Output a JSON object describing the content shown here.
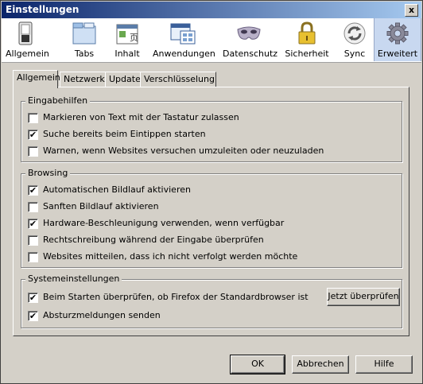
{
  "window": {
    "title": "Einstellungen",
    "close_label": "x"
  },
  "toolbar": {
    "items": [
      {
        "label": "Allgemein",
        "icon": "switch-icon"
      },
      {
        "label": "Tabs",
        "icon": "tabs-icon"
      },
      {
        "label": "Inhalt",
        "icon": "content-icon"
      },
      {
        "label": "Anwendungen",
        "icon": "applications-icon"
      },
      {
        "label": "Datenschutz",
        "icon": "mask-icon"
      },
      {
        "label": "Sicherheit",
        "icon": "lock-icon"
      },
      {
        "label": "Sync",
        "icon": "sync-icon"
      },
      {
        "label": "Erweitert",
        "icon": "gear-icon"
      }
    ],
    "selected": "Erweitert"
  },
  "tabs": [
    {
      "label": "Allgemein",
      "active": true
    },
    {
      "label": "Netzwerk",
      "active": false
    },
    {
      "label": "Update",
      "active": false
    },
    {
      "label": "Verschlüsselung",
      "active": false
    }
  ],
  "groups": {
    "eingabehilfen": {
      "title": "Eingabehilfen",
      "items": [
        {
          "label": "Markieren von Text mit der Tastatur zulassen",
          "checked": false
        },
        {
          "label": "Suche bereits beim Eintippen starten",
          "checked": true
        },
        {
          "label": "Warnen, wenn Websites versuchen umzuleiten oder neuzuladen",
          "checked": false
        }
      ]
    },
    "browsing": {
      "title": "Browsing",
      "items": [
        {
          "label": "Automatischen Bildlauf aktivieren",
          "checked": true
        },
        {
          "label": "Sanften Bildlauf aktivieren",
          "checked": false
        },
        {
          "label": "Hardware-Beschleunigung verwenden, wenn verfügbar",
          "checked": true
        },
        {
          "label": "Rechtschreibung während der Eingabe überprüfen",
          "checked": false
        },
        {
          "label": "Websites mitteilen, dass ich nicht verfolgt werden möchte",
          "checked": false
        }
      ]
    },
    "system": {
      "title": "Systemeinstellungen",
      "items": [
        {
          "label": "Beim Starten überprüfen, ob Firefox der Standardbrowser ist",
          "checked": true
        },
        {
          "label": "Absturzmeldungen senden",
          "checked": true
        }
      ],
      "check_now_label": "Jetzt überprüfen"
    }
  },
  "footer": {
    "ok_label": "OK",
    "cancel_label": "Abbrechen",
    "help_label": "Hilfe"
  },
  "check_mark": "✔"
}
